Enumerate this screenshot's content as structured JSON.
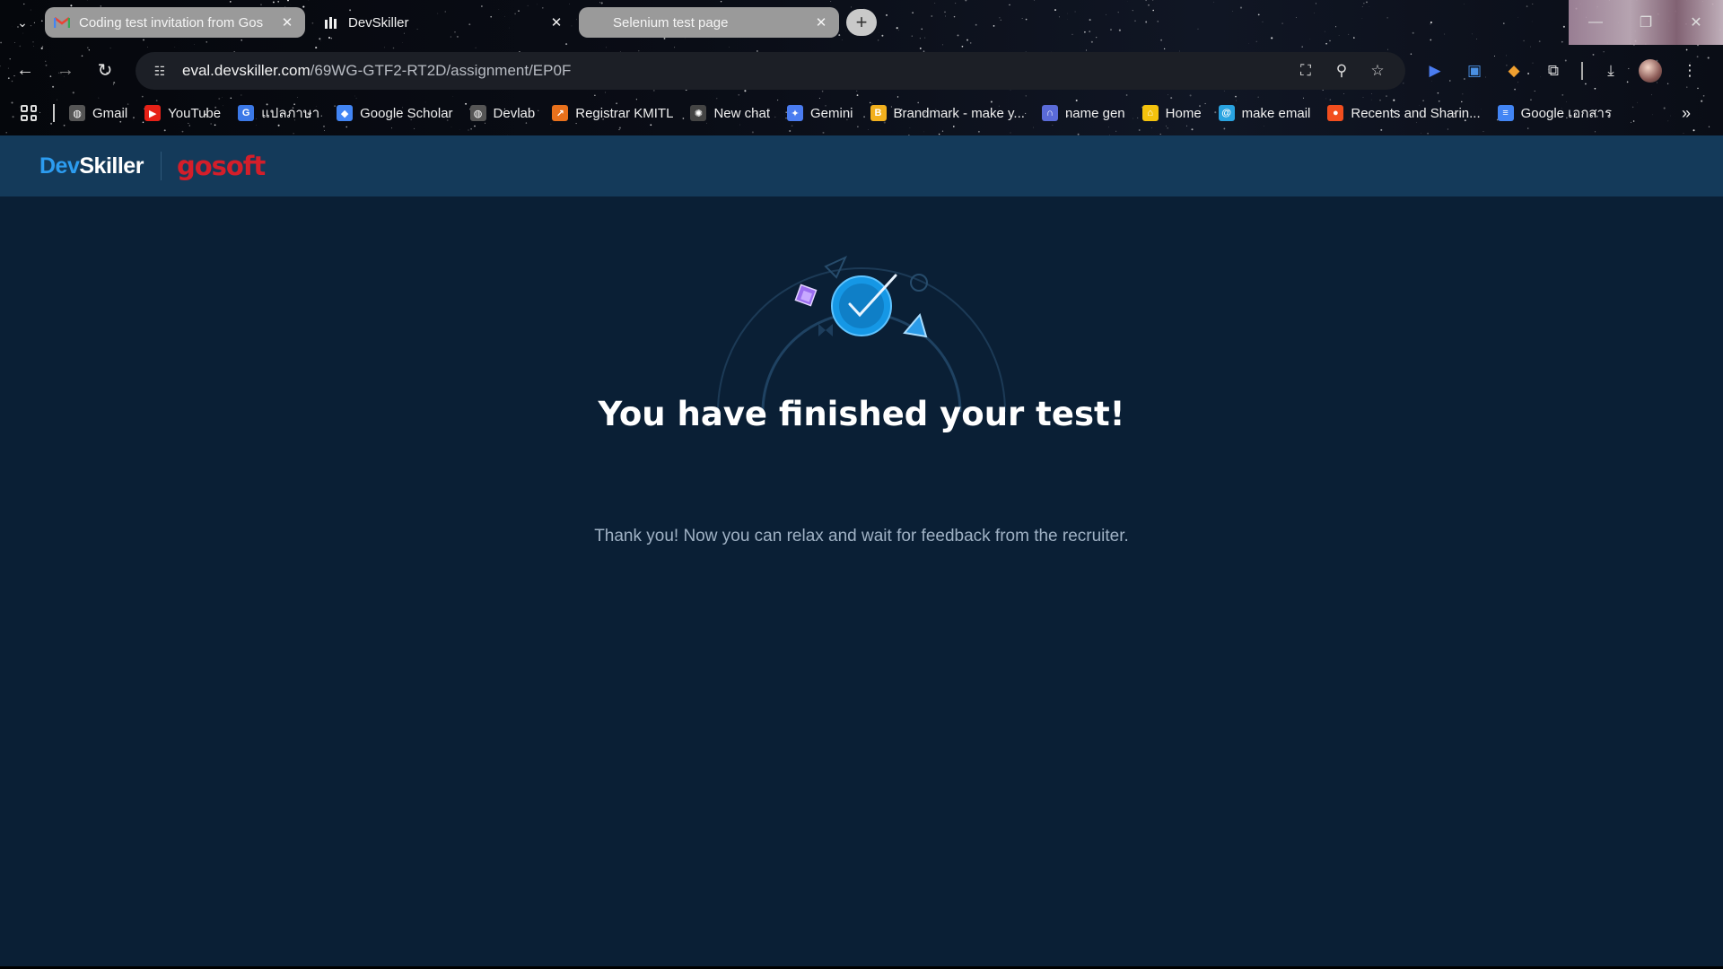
{
  "browser": {
    "tabs": [
      {
        "title": "Coding test invitation from Gos",
        "favicon": "gmail-icon",
        "state": "gray"
      },
      {
        "title": "DevSkiller",
        "favicon": "devskiller-icon",
        "state": "active"
      },
      {
        "title": "Selenium test page",
        "favicon": "",
        "state": "gray"
      }
    ],
    "url_host": "eval.devskiller.com",
    "url_path": "/69WG-GTF2-RT2D/assignment/EP0F",
    "bookmarks": [
      {
        "label": "Gmail",
        "icon": "globe-icon",
        "color": "#555555"
      },
      {
        "label": "YouTube",
        "icon": "youtube-icon",
        "color": "#e62117"
      },
      {
        "label": "แปลภาษา",
        "icon": "translate-icon",
        "color": "#3b78e7"
      },
      {
        "label": "Google Scholar",
        "icon": "scholar-icon",
        "color": "#4285f4"
      },
      {
        "label": "Devlab",
        "icon": "globe-icon",
        "color": "#555555"
      },
      {
        "label": "Registrar KMITL",
        "icon": "registrar-icon",
        "color": "#e8711c"
      },
      {
        "label": "New chat",
        "icon": "chatgpt-icon",
        "color": "#444444"
      },
      {
        "label": "Gemini",
        "icon": "gemini-icon",
        "color": "#4a7cf0"
      },
      {
        "label": "Brandmark - make y...",
        "icon": "brandmark-icon",
        "color": "#f2b01e"
      },
      {
        "label": "name gen",
        "icon": "namegen-icon",
        "color": "#5a6bd8"
      },
      {
        "label": "Home",
        "icon": "home-icon",
        "color": "#f4c20d"
      },
      {
        "label": "make email",
        "icon": "email-icon",
        "color": "#29a3e0"
      },
      {
        "label": "Recents and Sharin...",
        "icon": "figma-icon",
        "color": "#f24e1e"
      },
      {
        "label": "Google เอกสาร",
        "icon": "docs-icon",
        "color": "#4285f4"
      }
    ]
  },
  "app": {
    "brand_dev": "Dev",
    "brand_skiller": "Skiller",
    "partner_logo": "gosoft",
    "headline": "You have finished your test!",
    "message": "Thank you! Now you can relax and wait for feedback from the recruiter.",
    "colors": {
      "appbar": "#143a5a",
      "background": "#0a1f35",
      "accent": "#2c9cf0",
      "partner_red": "#d41e2a"
    }
  }
}
